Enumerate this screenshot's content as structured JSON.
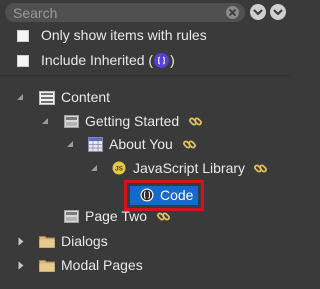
{
  "search": {
    "placeholder": "Search",
    "value": ""
  },
  "options": [
    {
      "label": "Only show items with rules",
      "checked": false
    },
    {
      "label_before": "Include Inherited (",
      "label_after": ")",
      "checked": false
    }
  ],
  "tree": {
    "content": {
      "label": "Content",
      "icon": "content-icon",
      "expanded": true
    },
    "getting_started": {
      "label": "Getting Started",
      "icon": "page-icon",
      "expanded": true
    },
    "about_you": {
      "label": "About You",
      "icon": "calendar-page-icon",
      "expanded": true
    },
    "javascript_library": {
      "label": "JavaScript Library",
      "icon": "js-icon",
      "expanded": true
    },
    "code": {
      "label": "Code",
      "icon": "code-icon",
      "selected": true
    },
    "page_two": {
      "label": "Page Two",
      "icon": "page-icon"
    },
    "dialogs": {
      "label": "Dialogs",
      "icon": "folder-icon",
      "expanded": false
    },
    "modal_pages": {
      "label": "Modal Pages",
      "icon": "folder-icon",
      "expanded": false
    }
  },
  "colors": {
    "background": "#3a3a3a",
    "selection": "#1668c9",
    "highlight_border": "#d4141c",
    "link_icon": "#e0c060",
    "folder": "#d9b87a"
  }
}
